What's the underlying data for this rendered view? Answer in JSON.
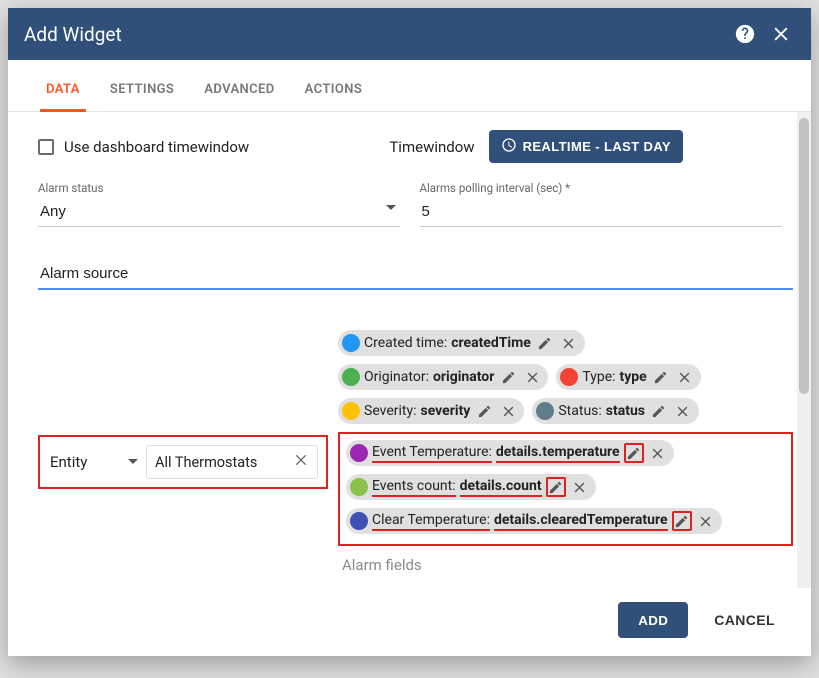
{
  "dialog": {
    "title": "Add Widget"
  },
  "tabs": [
    "DATA",
    "SETTINGS",
    "ADVANCED",
    "ACTIONS"
  ],
  "dashboardTimewindow": {
    "label": "Use dashboard timewindow"
  },
  "timewindow": {
    "label": "Timewindow",
    "button": "REALTIME - LAST DAY"
  },
  "alarmStatus": {
    "label": "Alarm status",
    "value": "Any"
  },
  "pollingInterval": {
    "label": "Alarms polling interval (sec) *",
    "value": "5"
  },
  "alarmSource": {
    "label": "Alarm source"
  },
  "entitySelect": {
    "value": "Entity"
  },
  "entityAlias": {
    "value": "All Thermostats"
  },
  "fields": {
    "created": {
      "label": "Created time: ",
      "value": "createdTime",
      "color": "#2196f3"
    },
    "originator": {
      "label": "Originator: ",
      "value": "originator",
      "color": "#4caf50"
    },
    "type": {
      "label": "Type: ",
      "value": "type",
      "color": "#f44336"
    },
    "severity": {
      "label": "Severity: ",
      "value": "severity",
      "color": "#ffc107"
    },
    "status": {
      "label": "Status: ",
      "value": "status",
      "color": "#607d8b"
    },
    "eventTemp": {
      "label": "Event Temperature: ",
      "value": "details.temperature",
      "color": "#9c27b0"
    },
    "eventsCount": {
      "label": "Events count: ",
      "value": "details.count",
      "color": "#8bc34a"
    },
    "clearTemp": {
      "label": "Clear Temperature: ",
      "value": "details.clearedTemperature",
      "color": "#3f51b5"
    }
  },
  "placeholder": "Alarm fields",
  "footer": {
    "add": "ADD",
    "cancel": "CANCEL"
  }
}
